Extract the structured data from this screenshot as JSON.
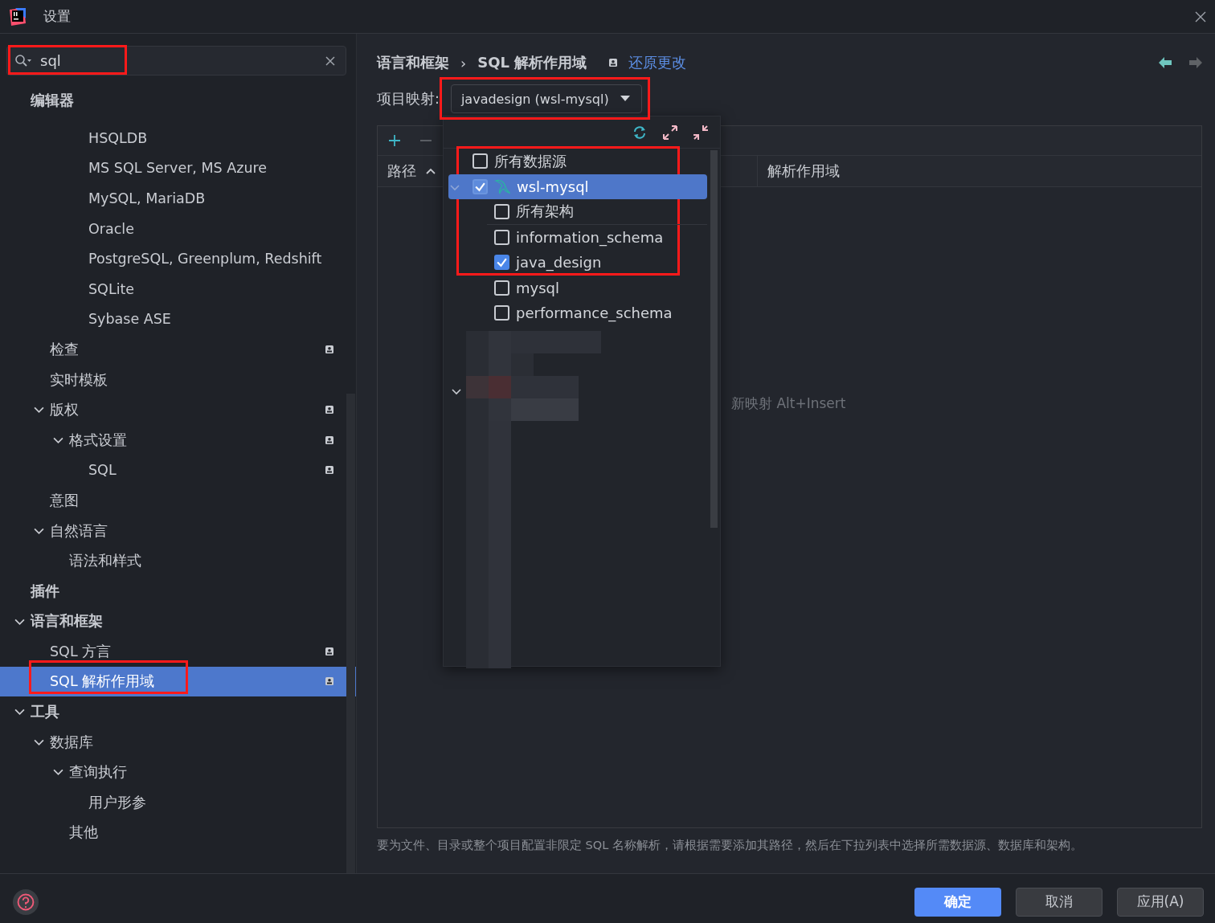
{
  "window": {
    "title": "设置"
  },
  "search": {
    "value": "sql"
  },
  "sidebar": {
    "items": [
      {
        "label": "编辑器",
        "children": [
          {
            "children": [
              {
                "children": [
                  {
                    "label": "HSQLDB",
                    "selected": false
                  },
                  {
                    "label": "MS SQL Server, MS Azure",
                    "selected": false
                  },
                  {
                    "label": "MySQL, MariaDB",
                    "selected": false
                  },
                  {
                    "label": "Oracle",
                    "selected": false
                  },
                  {
                    "label": "PostgreSQL, Greenplum, Redshift",
                    "selected": false
                  },
                  {
                    "label": "SQLite",
                    "selected": false
                  },
                  {
                    "label": "Sybase ASE",
                    "selected": false
                  }
                ]
              }
            ]
          },
          {
            "label": "检查",
            "selected": false,
            "project_level": true
          },
          {
            "label": "实时模板",
            "selected": false
          },
          {
            "label": "版权",
            "selected": false,
            "project_level": true,
            "expanded": true,
            "children": [
              {
                "label": "格式设置",
                "selected": false,
                "project_level": true,
                "expanded": true,
                "children": [
                  {
                    "label": "SQL",
                    "selected": false,
                    "project_level": true
                  }
                ]
              }
            ]
          },
          {
            "label": "意图",
            "selected": false
          },
          {
            "label": "自然语言",
            "selected": false,
            "expanded": true,
            "children": [
              {
                "label": "语法和样式",
                "selected": false
              }
            ]
          }
        ]
      },
      {
        "label": "插件",
        "selected": false
      },
      {
        "label": "语言和框架",
        "selected": false,
        "expanded": true,
        "children": [
          {
            "label": "SQL 方言",
            "selected": false,
            "project_level": true
          },
          {
            "label": "SQL 解析作用域",
            "selected": true,
            "project_level": true
          }
        ]
      },
      {
        "label": "工具",
        "selected": false,
        "expanded": true,
        "children": [
          {
            "label": "数据库",
            "selected": false,
            "expanded": true,
            "children": [
              {
                "label": "查询执行",
                "selected": false,
                "expanded": true,
                "children": [
                  {
                    "label": "用户形参",
                    "selected": false
                  }
                ]
              },
              {
                "label": "其他",
                "selected": false
              }
            ]
          }
        ]
      }
    ]
  },
  "breadcrumb": [
    "语言和框架",
    "SQL 解析作用域"
  ],
  "breadcrumb_separator": "›",
  "revert_link": "还原更改",
  "mapping": {
    "label": "项目映射:",
    "value": "javadesign (wsl-mysql)"
  },
  "table": {
    "columns": [
      {
        "label": "路径",
        "sorted_ascending": true
      },
      {
        "label": "解析作用域"
      }
    ],
    "empty_text": "新映射 Alt+Insert"
  },
  "popup": {
    "items": [
      {
        "label": "所有数据源",
        "kind": "all",
        "checked": false,
        "selected": false
      },
      {
        "label": "wsl-mysql",
        "kind": "datasource",
        "checked": true,
        "selected": true,
        "expanded": true,
        "children": [
          {
            "label": "所有架构",
            "kind": "all",
            "checked": false,
            "selected": false
          },
          {
            "label": "information_schema",
            "kind": "schema",
            "checked": false,
            "selected": false
          },
          {
            "label": "java_design",
            "kind": "schema",
            "checked": true,
            "selected": false
          },
          {
            "label": "mysql",
            "kind": "schema",
            "checked": false,
            "selected": false
          },
          {
            "label": "performance_schema",
            "kind": "schema",
            "checked": false,
            "selected": false
          }
        ]
      }
    ]
  },
  "description": "要为文件、目录或整个项目配置非限定 SQL 名称解析，请根据需要添加其路径，然后在下拉列表中选择所需数据源、数据库和架构。",
  "buttons": [
    {
      "label": "确定",
      "kind": "primary"
    },
    {
      "label": "取消",
      "kind": "normal"
    },
    {
      "label": "应用(A)",
      "kind": "normal"
    }
  ]
}
